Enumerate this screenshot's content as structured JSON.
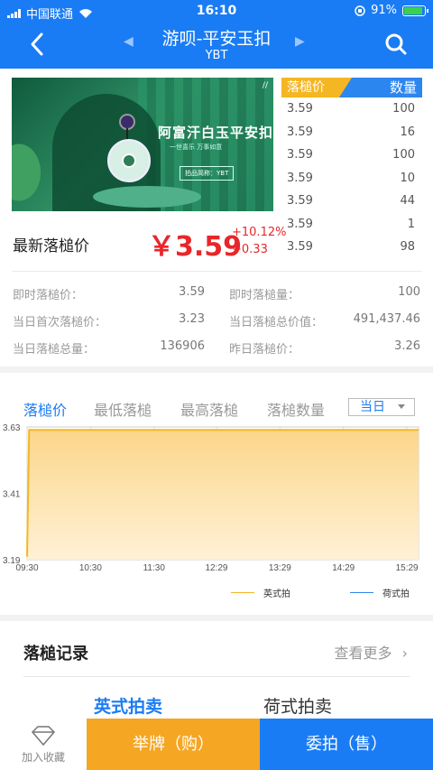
{
  "status": {
    "carrier": "中国联通",
    "time": "16:10",
    "battery": "91%"
  },
  "nav": {
    "title": "游呗-平安玉扣",
    "subtitle": "YBT"
  },
  "banner": {
    "title": "阿富汗白玉平安扣",
    "tagline": "一世喜乐 万事如意",
    "brand": "拍品简称：YBT",
    "corner": "//"
  },
  "product": {
    "price_label": "最新落槌价",
    "price": "￥3.59",
    "change_pct": "+10.12%",
    "change_abs": "+0.33"
  },
  "trades": {
    "header_price": "落槌价",
    "header_qty": "数量",
    "rows": [
      {
        "price": "3.59",
        "qty": "100"
      },
      {
        "price": "3.59",
        "qty": "16"
      },
      {
        "price": "3.59",
        "qty": "100"
      },
      {
        "price": "3.59",
        "qty": "10"
      },
      {
        "price": "3.59",
        "qty": "44"
      },
      {
        "price": "3.59",
        "qty": "1"
      },
      {
        "price": "3.59",
        "qty": "98"
      }
    ]
  },
  "stats": {
    "realtime_price_label": "即时落槌价：",
    "realtime_price": "3.59",
    "realtime_qty_label": "即时落槌量：",
    "realtime_qty": "100",
    "first_price_label": "当日首次落槌价：",
    "first_price": "3.23",
    "total_value_label": "当日落槌总价值：",
    "total_value": "491,437.46",
    "total_qty_label": "当日落槌总量：",
    "total_qty": "136906",
    "yesterday_label": "昨日落槌价：",
    "yesterday": "3.26"
  },
  "chart_tabs": [
    "落槌价",
    "最低落槌",
    "最高落槌",
    "落槌数量"
  ],
  "period": "当日",
  "chart_data": {
    "type": "area",
    "x": [
      "09:30",
      "09:32",
      "10:30",
      "11:30",
      "12:29",
      "13:29",
      "14:29",
      "15:29",
      "15:40"
    ],
    "series": [
      {
        "name": "英式拍",
        "values": [
          3.2,
          3.62,
          3.62,
          3.62,
          3.62,
          3.62,
          3.62,
          3.62,
          3.62
        ],
        "color": "#f5b623"
      },
      {
        "name": "荷式拍",
        "values": [],
        "color": "#2c86ef"
      }
    ],
    "xticks": [
      "09:30",
      "10:30",
      "11:30",
      "12:29",
      "13:29",
      "14:29",
      "15:29"
    ],
    "yticks": [
      "3.63",
      "3.41",
      "3.19"
    ],
    "ylim": [
      3.19,
      3.63
    ]
  },
  "records": {
    "title": "落槌记录",
    "more": "查看更多",
    "tab_english": "英式拍卖",
    "tab_dutch": "荷式拍卖"
  },
  "bottom": {
    "fav": "加入收藏",
    "buy": "举牌（购）",
    "sell": "委拍（售）"
  }
}
